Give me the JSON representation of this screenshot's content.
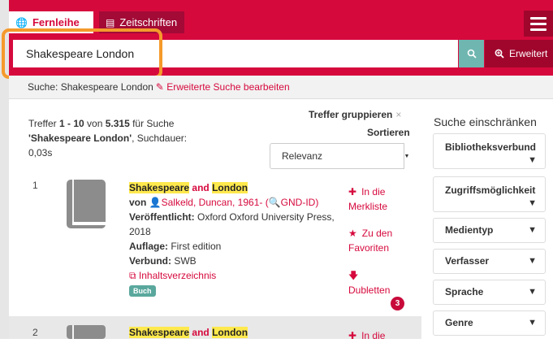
{
  "tabs": [
    {
      "label": "Fernleihe",
      "icon": "globe-icon",
      "active": true
    },
    {
      "label": "Zeitschriften",
      "icon": "newspaper-icon",
      "active": false
    }
  ],
  "search": {
    "value": "Shakespeare London",
    "advanced_label": "Erweitert"
  },
  "query_bar": {
    "prefix": "Suche: Shakespeare London",
    "edit_link": "Erweiterte Suche bearbeiten"
  },
  "summary": {
    "p1": "Treffer ",
    "range": "1 - 10",
    "p2": " von ",
    "total": "5.315",
    "p3": " für Suche",
    "query": "'Shakespeare London'",
    "p4": ", Suchdauer:",
    "time": "0,03s"
  },
  "controls": {
    "group_label": "Treffer gruppieren",
    "group_x": "×",
    "sort_label": "Sortieren",
    "sort_value": "Relevanz"
  },
  "sidebar": {
    "title": "Suche einschränken",
    "facets": [
      "Bibliotheksverbund",
      "Zugriffsmöglichkeit",
      "Medientyp",
      "Verfasser",
      "Sprache",
      "Genre"
    ]
  },
  "results": [
    {
      "num": "1",
      "title_a": "Shakespeare",
      "title_and": " and ",
      "title_b": "London",
      "by_label": "von ",
      "author": "Salkeld, Duncan, 1961-",
      "author_paren_open": " (",
      "gnd": "GND-ID",
      "author_paren_close": ")",
      "published_label": "Veröffentlicht:",
      "published_value": " Oxford Oxford University Press, 2018",
      "edition_label": "Auflage:",
      "edition_value": " First edition",
      "network_label": "Verbund:",
      "network_value": " SWB",
      "toc_link": "Inhaltsverzeichnis",
      "badge": "Buch",
      "actions": {
        "watchlist": "In die Merkliste",
        "favorites": "Zu den Favoriten",
        "duplicates": "Dubletten",
        "duplicates_count": "3"
      }
    },
    {
      "num": "2",
      "title_a": "Shakespeare",
      "title_and": " and ",
      "title_b": "London",
      "actions": {
        "watchlist": "In die"
      }
    }
  ]
}
